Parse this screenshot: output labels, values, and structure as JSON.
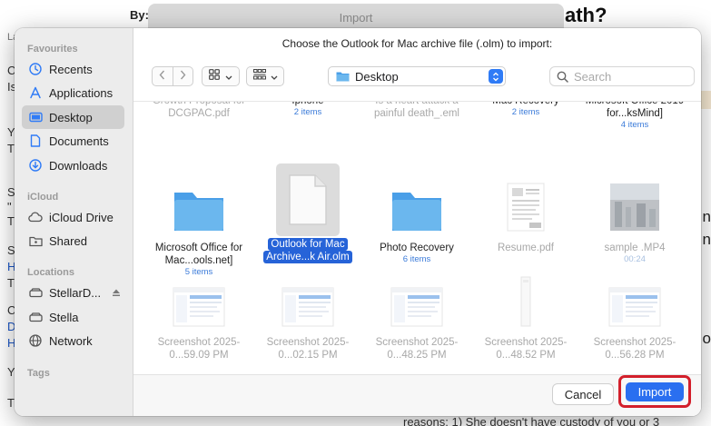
{
  "background": {
    "byline": "By:",
    "heading_fragment": "ath?",
    "window_title": "Import",
    "left_letters": [
      "La",
      "C",
      "Is",
      "Y",
      "T",
      "S",
      "\"",
      "T",
      "S",
      "H",
      "T",
      "C",
      "D",
      "H",
      "Y",
      "T"
    ],
    "right_letters": [
      "n",
      "n",
      "o"
    ],
    "bottom_text": "reasons: 1) She doesn't have custody of you or 3"
  },
  "dialog": {
    "prompt": "Choose the Outlook for Mac archive file (.olm) to import:"
  },
  "sidebar": {
    "favourites_label": "Favourites",
    "favourites": [
      {
        "label": "Recents",
        "icon": "clock-icon"
      },
      {
        "label": "Applications",
        "icon": "applications-icon"
      },
      {
        "label": "Desktop",
        "icon": "desktop-icon",
        "selected": true
      },
      {
        "label": "Documents",
        "icon": "document-icon"
      },
      {
        "label": "Downloads",
        "icon": "download-icon"
      }
    ],
    "icloud_label": "iCloud",
    "icloud": [
      {
        "label": "iCloud Drive",
        "icon": "cloud-icon"
      },
      {
        "label": "Shared",
        "icon": "shared-folder-icon"
      }
    ],
    "locations_label": "Locations",
    "locations": [
      {
        "label": "StellarD...",
        "icon": "drive-icon"
      },
      {
        "label": "Stella",
        "icon": "drive-icon"
      },
      {
        "label": "Network",
        "icon": "globe-icon"
      }
    ],
    "tags_label": "Tags"
  },
  "toolbar": {
    "location": "Desktop",
    "search_placeholder": "Search"
  },
  "files": [
    {
      "name": "Growth Proposal for DCGPAC.pdf",
      "meta": "",
      "kind": "partial",
      "dim": true
    },
    {
      "name": "Iphone",
      "meta": "2 items",
      "kind": "partial",
      "dim": false
    },
    {
      "name": "Is a heart attack a painful death_.eml",
      "meta": "",
      "kind": "partial",
      "dim": true
    },
    {
      "name": "Mac Recovery",
      "meta": "2 items",
      "kind": "partial",
      "dim": false
    },
    {
      "name": "Microsoft Office 2019 for...ksMind]",
      "meta": "4 items",
      "kind": "partial",
      "dim": false
    },
    {
      "name": "Microsoft Office for Mac...ools.net]",
      "meta": "5 items",
      "kind": "folder",
      "dim": false
    },
    {
      "name": "Outlook for Mac Archive...k Air.olm",
      "meta": "",
      "kind": "file",
      "dim": false,
      "selected": true
    },
    {
      "name": "Photo Recovery",
      "meta": "6 items",
      "kind": "folder",
      "dim": false
    },
    {
      "name": "Resume.pdf",
      "meta": "",
      "kind": "pdf",
      "dim": true
    },
    {
      "name": "sample .MP4",
      "meta": "00:24",
      "kind": "video",
      "dim": true
    },
    {
      "name": "Screenshot 2025-0...59.09 PM",
      "meta": "",
      "kind": "screenshot",
      "dim": true
    },
    {
      "name": "Screenshot 2025-0...02.15 PM",
      "meta": "",
      "kind": "screenshot",
      "dim": true
    },
    {
      "name": "Screenshot 2025-0...48.25 PM",
      "meta": "",
      "kind": "screenshot",
      "dim": true
    },
    {
      "name": "Screenshot 2025-0...48.52 PM",
      "meta": "",
      "kind": "screenshot-tall",
      "dim": true
    },
    {
      "name": "Screenshot 2025-0...56.28 PM",
      "meta": "",
      "kind": "screenshot",
      "dim": true
    }
  ],
  "footer": {
    "cancel_label": "Cancel",
    "import_label": "Import"
  },
  "colors": {
    "accent": "#2a6ff0",
    "selection": "#2663d8",
    "highlight_ring": "#d31f2b",
    "folder": "#6bb7ee"
  }
}
